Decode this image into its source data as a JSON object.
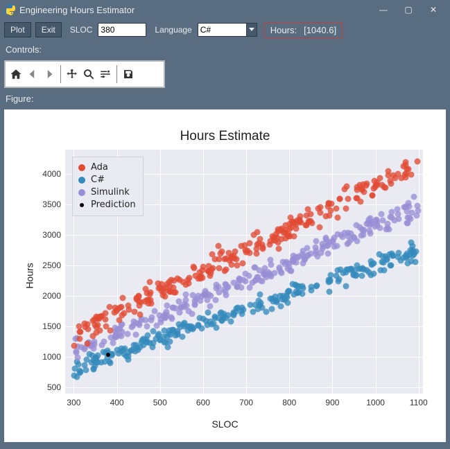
{
  "window": {
    "title": "Engineering Hours Estimator",
    "minimize": "—",
    "maximize": "▢",
    "close": "✕"
  },
  "toolbar": {
    "plot_btn": "Plot",
    "exit_btn": "Exit",
    "sloc_label": "SLOC",
    "sloc_value": "380",
    "language_label": "Language",
    "language_value": "C#",
    "hours_label": "Hours:",
    "hours_value": "[1040.6]"
  },
  "panels": {
    "controls_label": "Controls:",
    "figure_label": "Figure:"
  },
  "mpl_icons": {
    "home": "home-icon",
    "back": "back-icon",
    "forward": "forward-icon",
    "pan": "pan-icon",
    "zoom": "zoom-icon",
    "subplots": "configure-icon",
    "save": "save-icon"
  },
  "legend": {
    "ada": "Ada",
    "cs": "C#",
    "sim": "Simulink",
    "pred": "Prediction"
  },
  "colors": {
    "ada": "#e24a33",
    "cs": "#348abd",
    "sim": "#988ed5",
    "pred": "#000000"
  },
  "chart_data": {
    "type": "scatter",
    "title": "Hours Estimate",
    "xlabel": "SLOC",
    "ylabel": "Hours",
    "xlim": [
      280,
      1110
    ],
    "ylim": [
      400,
      4400
    ],
    "xticks": [
      300,
      400,
      500,
      600,
      700,
      800,
      900,
      1000,
      1100
    ],
    "yticks": [
      500,
      1000,
      1500,
      2000,
      2500,
      3000,
      3500,
      4000
    ],
    "series": [
      {
        "name": "Ada",
        "color": "#e24a33",
        "slope": 3.45,
        "intercept": 350,
        "spread": 380,
        "n": 260
      },
      {
        "name": "C#",
        "color": "#348abd",
        "slope": 2.45,
        "intercept": 60,
        "spread": 320,
        "n": 260
      },
      {
        "name": "Simulink",
        "color": "#988ed5",
        "slope": 2.95,
        "intercept": 200,
        "spread": 360,
        "n": 260
      }
    ],
    "prediction": {
      "x": 380,
      "y": 1040.6
    }
  }
}
